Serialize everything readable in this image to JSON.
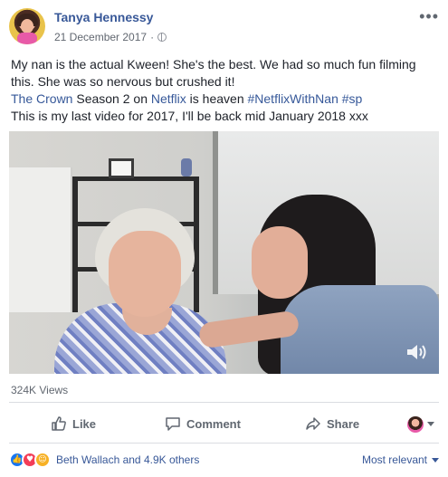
{
  "post": {
    "author": "Tanya Hennessy",
    "date": "21 December 2017",
    "meta_separator": "·",
    "more_menu": "•••",
    "text": {
      "line1": "My nan is the actual Kween! She's the best. We had so much fun filming this. She was so nervous but crushed it!",
      "link_crown": "The Crown",
      "season": " Season 2 on ",
      "link_netflix": "Netflix",
      "is_heaven": " is heaven ",
      "hashtag1": "#NetflixWithNan",
      "hashtag_sep": " ",
      "hashtag2": "#sp",
      "line3": "This is my last video for 2017, I'll be back mid January 2018 xxx"
    },
    "views": "324K Views"
  },
  "actions": {
    "like_label": "Like",
    "comment_label": "Comment",
    "share_label": "Share"
  },
  "reactions": {
    "summary": "Beth Wallach and 4.9K others",
    "sort_label": "Most relevant"
  },
  "colors": {
    "link": "#385898",
    "text": "#1d2129",
    "secondary": "#616770",
    "like": "#1877f2",
    "love": "#f33e58",
    "haha": "#f7b125"
  }
}
